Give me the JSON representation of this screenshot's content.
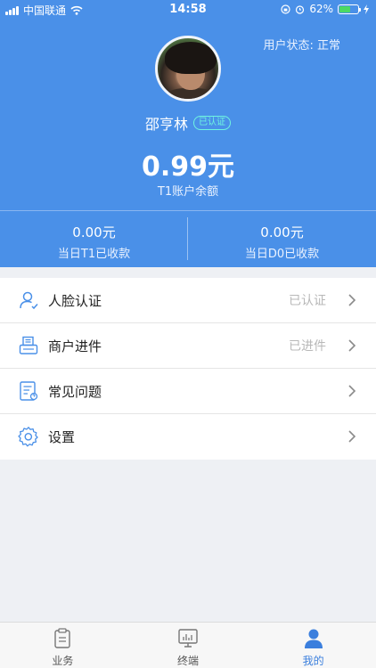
{
  "status_bar": {
    "carrier": "中国联通",
    "time": "14:58",
    "battery_percent": "62%",
    "battery_level": 0.62
  },
  "profile": {
    "user_status": "用户状态: 正常",
    "name": "邵亨林",
    "verified_badge": "已认证",
    "balance": "0.99元",
    "balance_label": "T1账户余额"
  },
  "stats": [
    {
      "amount": "0.00元",
      "label": "当日T1已收款"
    },
    {
      "amount": "0.00元",
      "label": "当日D0已收款"
    }
  ],
  "menu": [
    {
      "icon": "face-auth-icon",
      "label": "人脸认证",
      "value": "已认证"
    },
    {
      "icon": "merchant-icon",
      "label": "商户进件",
      "value": "已进件"
    },
    {
      "icon": "faq-icon",
      "label": "常见问题",
      "value": ""
    },
    {
      "icon": "settings-icon",
      "label": "设置",
      "value": ""
    }
  ],
  "tabs": [
    {
      "icon": "business-icon",
      "label": "业务",
      "active": false
    },
    {
      "icon": "terminal-icon",
      "label": "终端",
      "active": false
    },
    {
      "icon": "profile-icon",
      "label": "我的",
      "active": true
    }
  ],
  "colors": {
    "header_bg": "#4a90e8",
    "accent": "#3b7fdd",
    "verified": "#6ff5e0"
  }
}
